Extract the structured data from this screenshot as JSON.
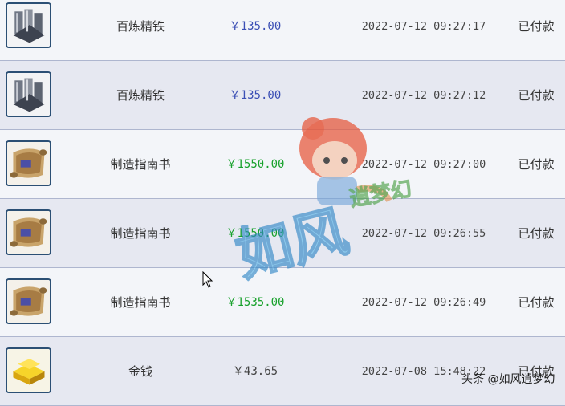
{
  "orders": [
    {
      "name": "百炼精铁",
      "price": "￥135.00",
      "price_color": "#3b4fb5",
      "time": "2022-07-12 09:27:17",
      "status": "已付款",
      "icon": "iron-ingot-icon"
    },
    {
      "name": "百炼精铁",
      "price": "￥135.00",
      "price_color": "#3b4fb5",
      "time": "2022-07-12 09:27:12",
      "status": "已付款",
      "icon": "iron-ingot-icon"
    },
    {
      "name": "制造指南书",
      "price": "￥1550.00",
      "price_color": "#18a12c",
      "time": "2022-07-12 09:27:00",
      "status": "已付款",
      "icon": "scroll-book-icon"
    },
    {
      "name": "制造指南书",
      "price": "￥1550.00",
      "price_color": "#18a12c",
      "time": "2022-07-12 09:26:55",
      "status": "已付款",
      "icon": "scroll-book-icon"
    },
    {
      "name": "制造指南书",
      "price": "￥1535.00",
      "price_color": "#18a12c",
      "time": "2022-07-12 09:26:49",
      "status": "已付款",
      "icon": "scroll-book-icon"
    },
    {
      "name": "金钱",
      "price": "￥43.65",
      "price_color": "#444444",
      "time": "2022-07-08 15:48:22",
      "status": "已付款",
      "icon": "gold-bars-icon"
    }
  ],
  "watermark": {
    "line1": "如风",
    "line2": "逍梦幻"
  },
  "footer_watermark": "头条 @如风逍梦幻"
}
